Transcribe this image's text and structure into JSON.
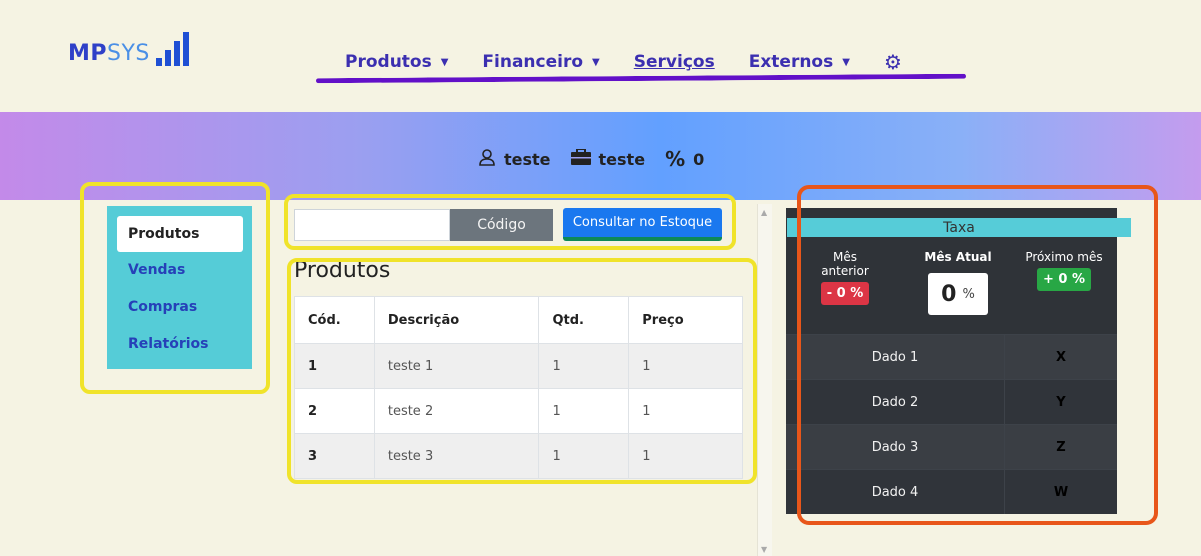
{
  "logo": {
    "mp": "MP",
    "sys": "SYS"
  },
  "nav": {
    "produtos": "Produtos",
    "financeiro": "Financeiro",
    "servicos": "Serviços",
    "externos": "Externos"
  },
  "user_info": {
    "user": "teste",
    "company": "teste",
    "percent_symbol": "%",
    "percent_value": "0"
  },
  "sidebar": {
    "items": [
      {
        "label": "Produtos"
      },
      {
        "label": "Vendas"
      },
      {
        "label": "Compras"
      },
      {
        "label": "Relatórios"
      }
    ]
  },
  "search": {
    "codigo_label": "Código",
    "consult_label": "Consultar no Estoque"
  },
  "products": {
    "title": "Produtos",
    "columns": [
      "Cód.",
      "Descrição",
      "Qtd.",
      "Preço"
    ],
    "rows": [
      [
        "1",
        "teste 1",
        "1",
        "1"
      ],
      [
        "2",
        "teste 2",
        "1",
        "1"
      ],
      [
        "3",
        "teste 3",
        "1",
        "1"
      ]
    ]
  },
  "rate": {
    "header": "Taxa",
    "previous_label": "Mês anterior",
    "previous_value": "- 0 %",
    "current_label": "Mês Atual",
    "current_value": "0",
    "current_unit": "%",
    "next_label": "Próximo mês",
    "next_value": "+ 0 %",
    "rows": [
      [
        "Dado 1",
        "X"
      ],
      [
        "Dado 2",
        "Y"
      ],
      [
        "Dado 3",
        "Z"
      ],
      [
        "Dado 4",
        "W"
      ]
    ]
  },
  "colors": {
    "accent": "#3b2fb0",
    "sidebar_bg": "#55ccd7",
    "negative_badge": "#dc3545",
    "positive_badge": "#28a745"
  }
}
